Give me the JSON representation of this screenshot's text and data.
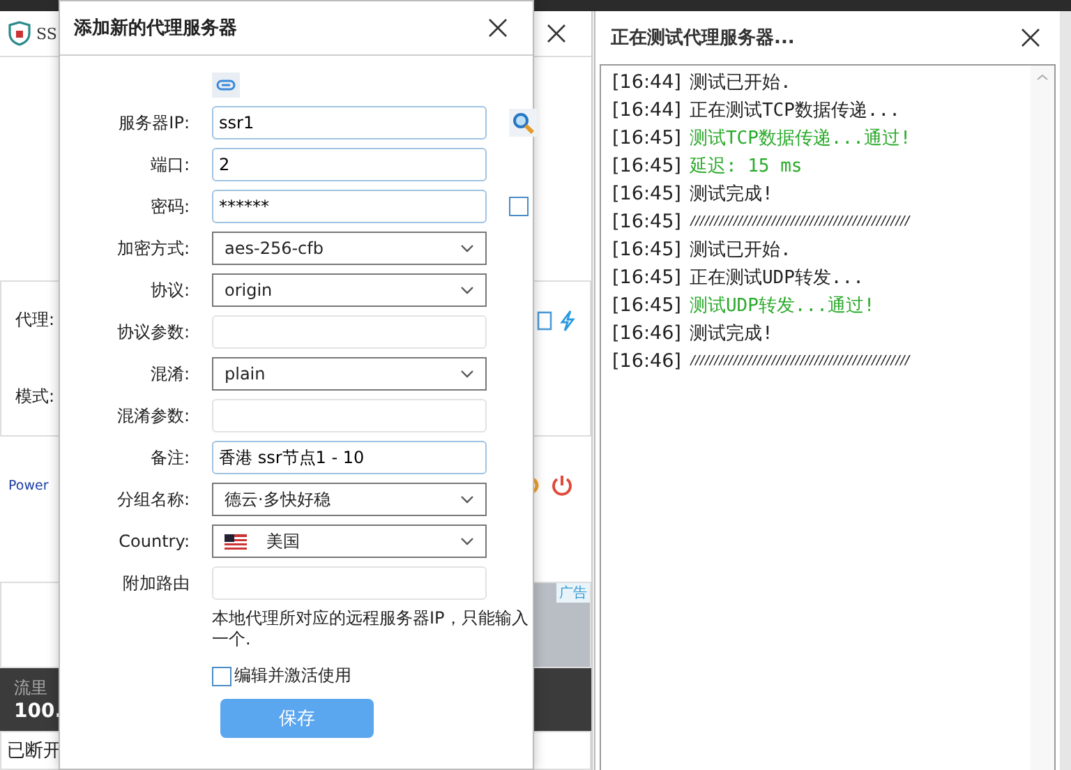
{
  "background_window": {
    "title": "SS",
    "proxy_label": "代理:",
    "mode_label": "模式:",
    "power_link": "Power",
    "ad_badge": "广告",
    "traffic_label": "流里",
    "traffic_value": "100.",
    "status": "已断开"
  },
  "dialog": {
    "title": "添加新的代理服务器",
    "fields": [
      {
        "kind": "ip",
        "label": "服务器IP:",
        "value": "ssr1"
      },
      {
        "kind": "text",
        "label": "端口:",
        "value": "2"
      },
      {
        "kind": "password",
        "label": "密码:",
        "value": "******",
        "checked": false
      },
      {
        "kind": "select",
        "label": "加密方式:",
        "value": "aes-256-cfb"
      },
      {
        "kind": "select",
        "label": "协议:",
        "value": "origin"
      },
      {
        "kind": "text",
        "label": "协议参数:"
      },
      {
        "kind": "select",
        "label": "混淆:",
        "value": "plain"
      },
      {
        "kind": "text",
        "label": "混淆参数:"
      },
      {
        "kind": "text",
        "label": "备注:",
        "value": "香港 ssr节点1 - 10"
      },
      {
        "kind": "select",
        "label": "分组名称:",
        "value": "德云·多快好稳"
      },
      {
        "kind": "country",
        "label": "Country:",
        "value": "美国"
      },
      {
        "kind": "text",
        "label": "附加路由"
      }
    ],
    "help_text": "本地代理所对应的远程服务器IP，只能输入一个.",
    "activate": {
      "label": "编辑并激活使用",
      "checked": false
    },
    "save_button": "保存"
  },
  "test_window": {
    "title": "正在测试代理服务器...",
    "log": [
      {
        "time": "[16:44]",
        "text": "测试已开始.",
        "kind": "info"
      },
      {
        "time": "[16:44]",
        "text": "正在测试TCP数据传递...",
        "kind": "info"
      },
      {
        "time": "[16:45]",
        "text": "测试TCP数据传递...通过!",
        "kind": "success"
      },
      {
        "time": "[16:45]",
        "text": "延迟: 15 ms",
        "kind": "success"
      },
      {
        "time": "[16:45]",
        "text": "测试完成!",
        "kind": "info"
      },
      {
        "time": "[16:45]",
        "text": "//////////////////////////////////////////////",
        "kind": "separator"
      },
      {
        "time": "[16:45]",
        "text": "测试已开始.",
        "kind": "info"
      },
      {
        "time": "[16:45]",
        "text": "正在测试UDP转发...",
        "kind": "info"
      },
      {
        "time": "[16:45]",
        "text": "测试UDP转发...通过!",
        "kind": "success"
      },
      {
        "time": "[16:46]",
        "text": "测试完成!",
        "kind": "info"
      },
      {
        "time": "[16:46]",
        "text": "//////////////////////////////////////////////",
        "kind": "separator"
      }
    ]
  }
}
